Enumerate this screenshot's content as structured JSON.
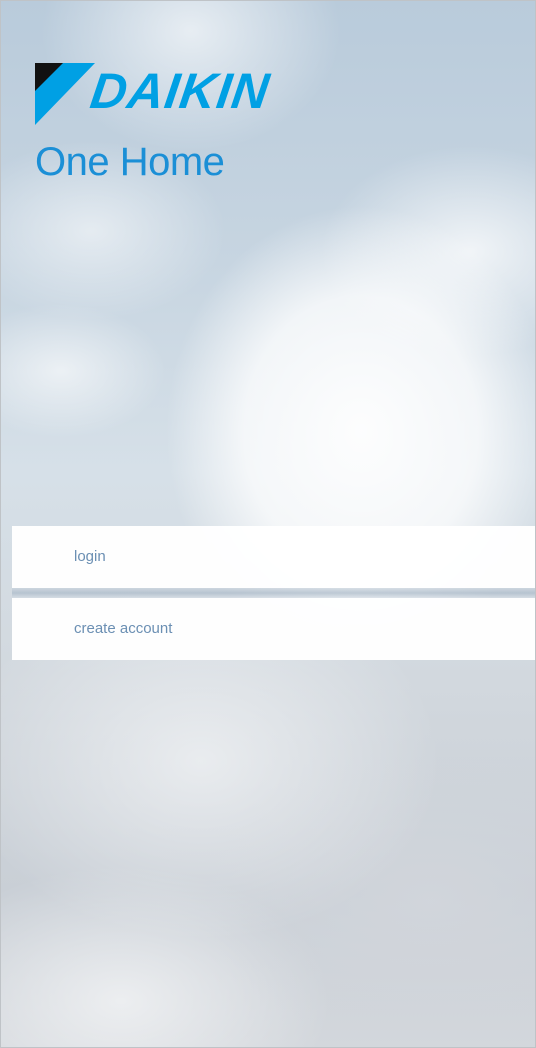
{
  "brand": {
    "logo_icon": "daikin-triangle-logo-icon",
    "name": "DAIKIN",
    "app_name": "One Home",
    "colors": {
      "logo_blue": "#00a0e4",
      "logo_dark": "#000000",
      "app_name": "#1b8fd6"
    }
  },
  "menu": {
    "login_label": "login",
    "create_account_label": "create account",
    "label_color": "#6b8fb3"
  },
  "background": "cloudy-sky-image"
}
